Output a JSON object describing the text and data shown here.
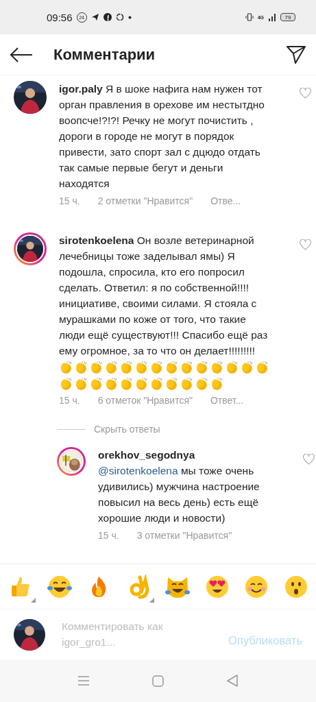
{
  "status_bar": {
    "time": "09:56",
    "badge": "24",
    "network": "4G",
    "battery": "79"
  },
  "header": {
    "title": "Комментарии"
  },
  "comments": [
    {
      "username": "igor.paly",
      "ring": false,
      "text": "Я в шоке нафига нам нужен тот орган правления в орехове им нестытдно воопсче!?!?! Речку не могут почистить , дороги в городе не могут в порядок привести, зато спорт зал с дцюдо отдать так самые первые бегут и деньги находятся",
      "time": "15 ч.",
      "likes": "2 отметки \"Нравится\"",
      "reply": "Отве...",
      "liked": false
    },
    {
      "username": "sirotenkoelena",
      "ring": true,
      "text": "Он возле ветеринарной лечебницы тоже заделывал ямы) Я подошла, спросила, кто его попросил сделать. Ответил: я по собственной!!!! инициативе, своими силами. Я стояла с мурашками по коже от того, что такие люди ещё существуют!!! Спасибо ещё раз ему огромное, за то что он делает!!!!!!!!!",
      "emoji": [
        {
          "kind": "clap"
        },
        {
          "kind": "clap"
        },
        {
          "kind": "clap"
        },
        {
          "kind": "clap"
        },
        {
          "kind": "clap"
        },
        {
          "kind": "clap"
        },
        {
          "kind": "clap"
        },
        {
          "kind": "clap"
        },
        {
          "kind": "clap"
        },
        {
          "kind": "clap"
        },
        {
          "kind": "clap"
        },
        {
          "kind": "clap"
        },
        {
          "kind": "clap"
        },
        {
          "kind": "clap"
        },
        {
          "kind": "clap"
        },
        {
          "kind": "clap"
        },
        {
          "kind": "clap"
        },
        {
          "kind": "clap"
        },
        {
          "kind": "clap"
        },
        {
          "kind": "clap"
        },
        {
          "kind": "clap"
        },
        {
          "kind": "clap"
        },
        {
          "kind": "clap"
        },
        {
          "kind": "clap"
        },
        {
          "kind": "clap"
        }
      ],
      "time": "15 ч.",
      "likes": "6 отметок \"Нравится\"",
      "reply": "Ответ...",
      "liked": false,
      "hide_replies": "Скрыть ответы",
      "replies": [
        {
          "username": "orekhov_segodnya",
          "ring": true,
          "mention": "@sirotenkoelena",
          "text": "мы тоже очень удивились) мужчина настроение повысил на весь день) есть ещё хорошие люди и новости)",
          "time": "15 ч.",
          "likes": "3 отметки \"Нравится\"",
          "liked": false
        }
      ]
    }
  ],
  "emoji_bar": [
    {
      "kind": "thumbs-up",
      "variants": true
    },
    {
      "kind": "tears-of-joy",
      "variants": false
    },
    {
      "kind": "fire",
      "variants": false
    },
    {
      "kind": "ok-hand",
      "variants": true
    },
    {
      "kind": "cat-tears",
      "variants": false
    },
    {
      "kind": "heart-eyes",
      "variants": false
    },
    {
      "kind": "smile",
      "variants": false
    },
    {
      "kind": "surprised",
      "variants": false
    }
  ],
  "composer": {
    "placeholder": "Комментировать как igor_gro1...",
    "post": "Опубликовать"
  }
}
